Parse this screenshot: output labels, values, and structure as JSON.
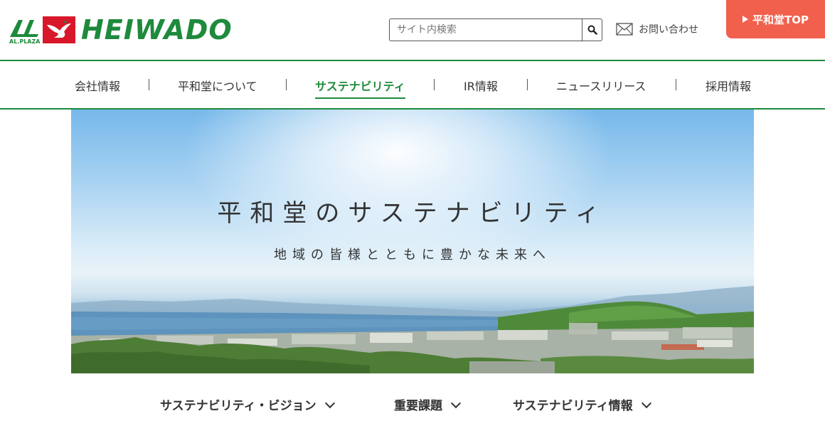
{
  "header": {
    "logo_sub": "AL.PLAZA",
    "logo_word": "HEIWADO",
    "search_placeholder": "サイト内検索",
    "contact_label": "お問い合わせ",
    "top_button_label": "平和堂TOP"
  },
  "gnav": {
    "items": [
      {
        "label": "会社情報"
      },
      {
        "label": "平和堂について"
      },
      {
        "label": "サステナビリティ"
      },
      {
        "label": "IR情報"
      },
      {
        "label": "ニュースリリース"
      },
      {
        "label": "採用情報"
      }
    ],
    "active_index": 2
  },
  "hero": {
    "title": "平和堂のサステナビリティ",
    "subtitle": "地域の皆様とともに豊かな未来へ"
  },
  "subnav": {
    "items": [
      {
        "label": "サステナビリティ・ビジョン"
      },
      {
        "label": "重要課題"
      },
      {
        "label": "サステナビリティ情報"
      }
    ]
  },
  "colors": {
    "brand_green": "#1e8a3c",
    "brand_red": "#d8182a",
    "top_button": "#f0604d"
  },
  "icons": {
    "search": "magnifier-icon",
    "contact": "envelope-icon",
    "subnav_toggle": "chevron-down-icon"
  }
}
